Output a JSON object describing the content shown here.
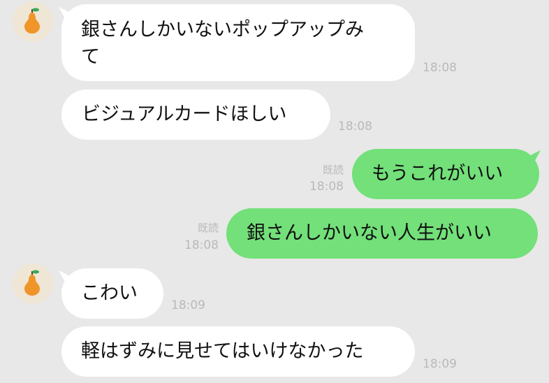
{
  "colors": {
    "background": "#e8e8e8",
    "incoming_bubble": "#ffffff",
    "outgoing_bubble": "#73e07a",
    "meta_text": "#b9b9b9"
  },
  "contact": {
    "avatar_icon": "pear-icon"
  },
  "messages": [
    {
      "direction": "incoming",
      "line1": "銀さんしかいないポップアップみ",
      "line2": "て",
      "time": "18:08"
    },
    {
      "direction": "incoming",
      "text": "ビジュアルカードほしい",
      "time": "18:08"
    },
    {
      "direction": "outgoing",
      "text": "もうこれがいい",
      "read": "既読",
      "time": "18:08"
    },
    {
      "direction": "outgoing",
      "text": "銀さんしかいない人生がいい",
      "read": "既読",
      "time": "18:08"
    },
    {
      "direction": "incoming",
      "text": "こわい",
      "time": "18:09"
    },
    {
      "direction": "incoming",
      "text": "軽はずみに見せてはいけなかった",
      "time": "18:09"
    }
  ]
}
